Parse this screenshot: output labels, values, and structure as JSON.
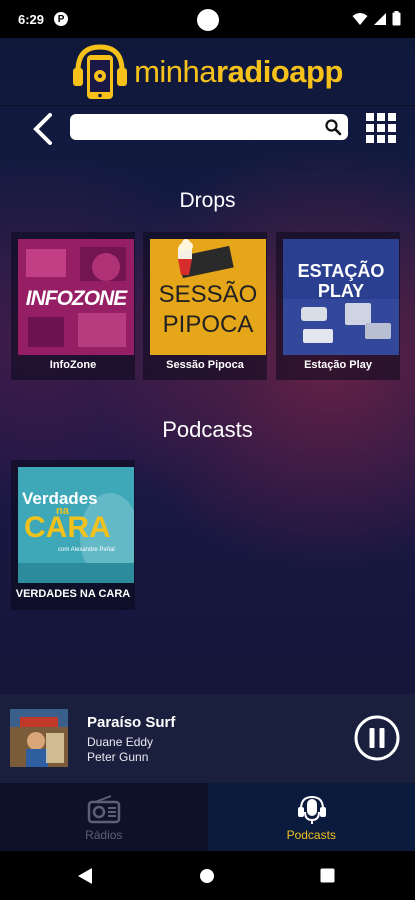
{
  "status": {
    "time": "6:29",
    "notif_letter": "P"
  },
  "app": {
    "logo_prefix": "minha",
    "logo_middle": "radio",
    "logo_suffix": "app"
  },
  "search": {
    "value": "",
    "placeholder": ""
  },
  "sections": {
    "drops": {
      "title": "Drops",
      "items": [
        {
          "label": "InfoZone",
          "art_text": "INFOZONE"
        },
        {
          "label": "Sessão Pipoca",
          "art_line1": "SESSÃO",
          "art_line2": "PIPOCA"
        },
        {
          "label": "Estação Play",
          "art_line1": "ESTAÇÃO",
          "art_line2": "PLAY"
        }
      ]
    },
    "podcasts": {
      "title": "Podcasts",
      "items": [
        {
          "label": "VERDADES NA CARA",
          "art_line1": "Verdades",
          "art_line2": "na",
          "art_line3": "CARA",
          "art_sub": "com Alexandre Peñal"
        }
      ]
    }
  },
  "player": {
    "title": "Paraíso Surf",
    "artist": "Duane Eddy",
    "song": "Peter Gunn",
    "state": "playing"
  },
  "tabs": [
    {
      "label": "Rádios",
      "icon": "radio-icon",
      "active": false
    },
    {
      "label": "Podcasts",
      "icon": "microphone-icon",
      "active": true
    }
  ],
  "colors": {
    "accent": "#f2c21c",
    "background": "#141b45",
    "player": "#1b1f3e"
  }
}
